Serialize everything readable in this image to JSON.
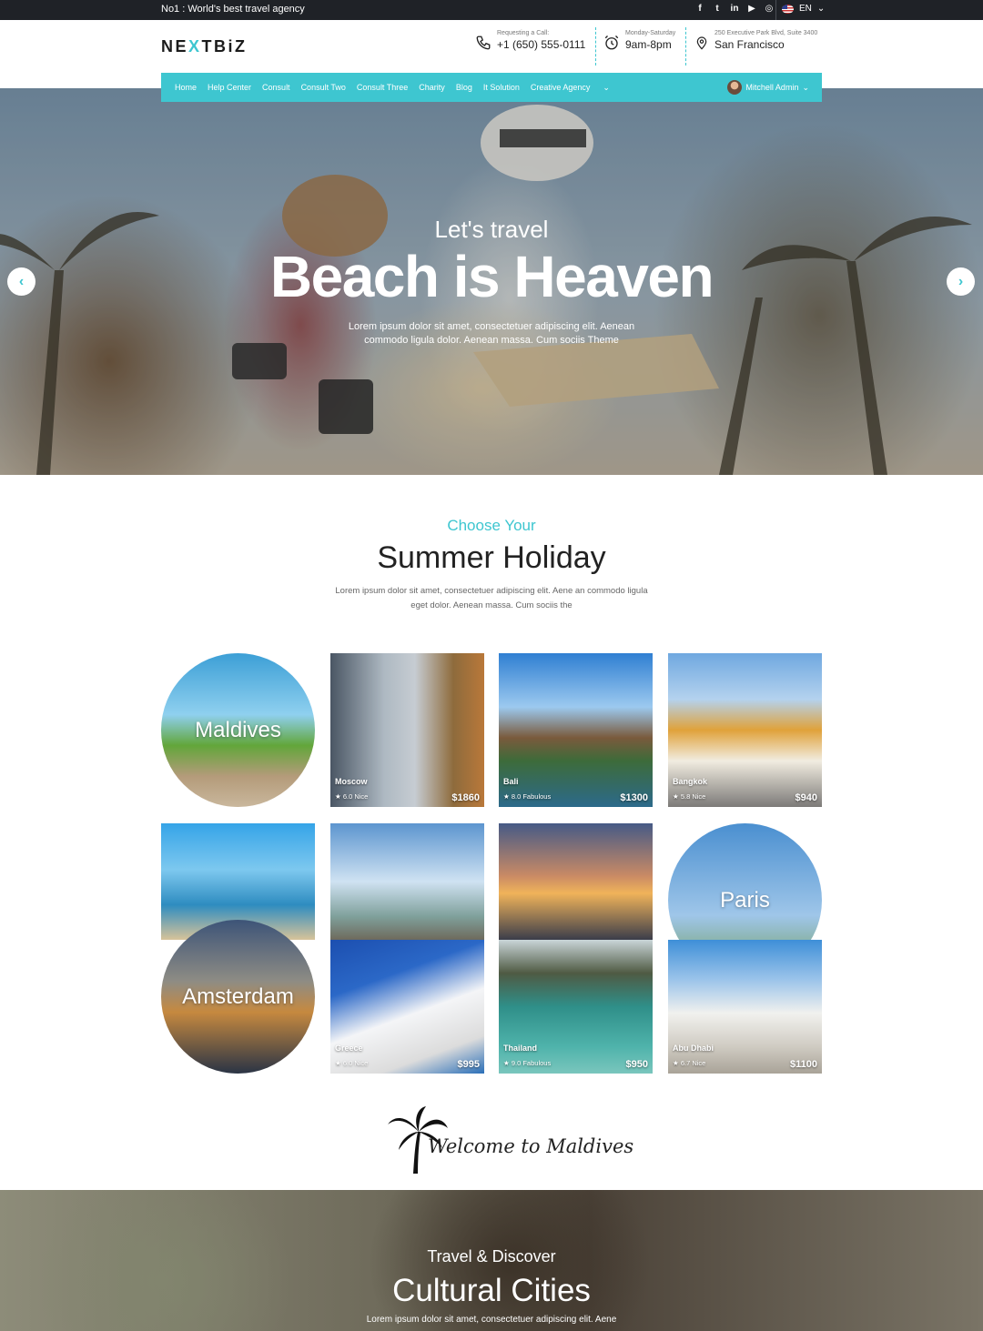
{
  "topbar": {
    "tagline": "No1 : World's best travel agency",
    "social": [
      "facebook-icon",
      "twitter-icon",
      "linkedin-icon",
      "youtube-icon",
      "instagram-icon"
    ],
    "social_glyphs": [
      "f",
      "t",
      "in",
      "▶",
      "◎"
    ],
    "language": "EN"
  },
  "header": {
    "logo_parts": [
      "NE",
      "X",
      "TBiZ"
    ],
    "phone": {
      "label": "Requesting a Call:",
      "value": "+1 (650) 555-0111"
    },
    "hours": {
      "label": "Monday-Saturday",
      "value": "9am-8pm"
    },
    "address": {
      "label": "250 Executive Park Blvd, Suite 3400",
      "value": "San Francisco"
    }
  },
  "nav": {
    "items": [
      "Home",
      "Help Center",
      "Consult",
      "Consult Two",
      "Consult Three",
      "Charity",
      "Blog",
      "It Solution",
      "Creative Agency"
    ],
    "user": "Mitchell Admin"
  },
  "hero": {
    "subtitle": "Let's travel",
    "title": "Beach is Heaven",
    "description": "Lorem ipsum dolor sit amet, consectetuer adipiscing elit. Aenean commodo ligula dolor. Aenean massa. Cum sociis Theme"
  },
  "section": {
    "kicker": "Choose Your",
    "title": "Summer Holiday",
    "description": "Lorem ipsum dolor sit amet, consectetuer adipiscing elit. Aene an commodo ligula eget dolor. Aenean massa. Cum sociis the"
  },
  "destinations": {
    "maldives": {
      "name": "Maldives"
    },
    "moscow": {
      "name": "Moscow",
      "score": "6.0",
      "verdict": "Nice",
      "price": "$1860"
    },
    "bali": {
      "name": "Bali",
      "score": "8.0",
      "verdict": "Fabulous",
      "price": "$1300"
    },
    "bangkok": {
      "name": "Bangkok",
      "score": "5.8",
      "verdict": "Nice",
      "price": "$940"
    },
    "paris": {
      "name": "Paris"
    },
    "amsterdam": {
      "name": "Amsterdam"
    },
    "greece": {
      "name": "Greece",
      "score": "6.0",
      "verdict": "Nice",
      "price": "$995"
    },
    "thailand": {
      "name": "Thailand",
      "score": "9.0",
      "verdict": "Fabulous",
      "price": "$950"
    },
    "abudhabi": {
      "name": "Abu Dhabi",
      "score": "6.7",
      "verdict": "Nice",
      "price": "$1100"
    }
  },
  "welcome": "Welcome to Maldives",
  "bottom": {
    "kicker": "Travel & Discover",
    "title": "Cultural Cities",
    "description": "Lorem ipsum dolor sit amet, consectetuer adipiscing elit. Aene"
  },
  "colors": {
    "accent": "#3ec6d0",
    "topbar": "#1f2227"
  }
}
